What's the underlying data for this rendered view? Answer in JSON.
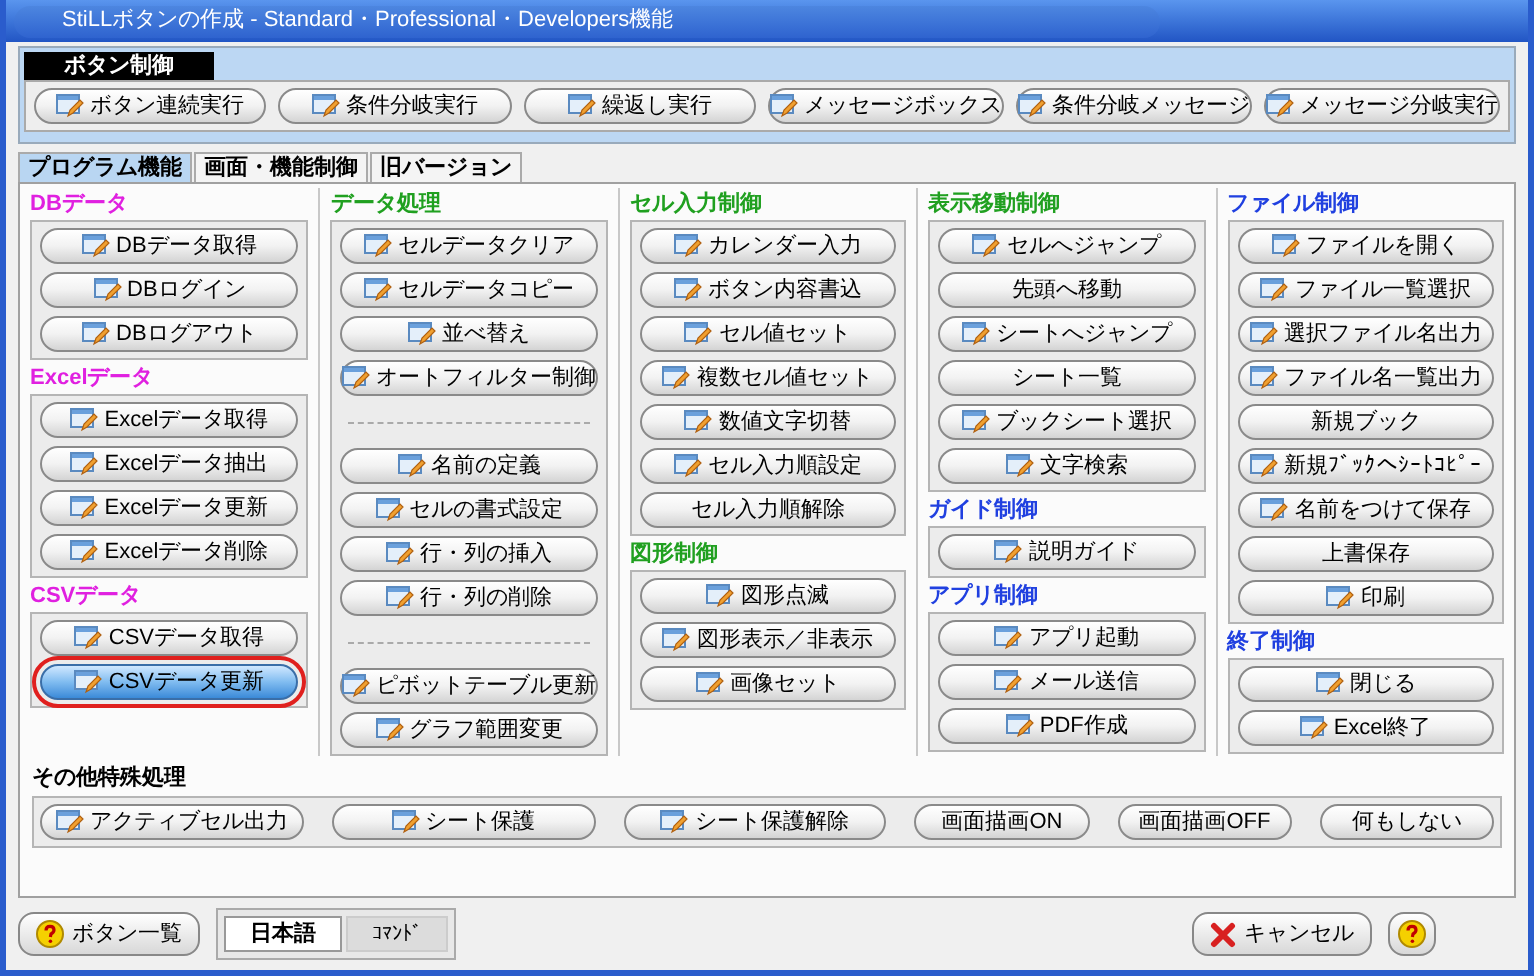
{
  "window": {
    "title": "StiLLボタンの作成 - Standard・Professional・Developers機能"
  },
  "button_control": {
    "title": "ボタン制御",
    "buttons": [
      {
        "label": "ボタン連続実行",
        "icon": true
      },
      {
        "label": "条件分岐実行",
        "icon": true
      },
      {
        "label": "繰返し実行",
        "icon": true
      },
      {
        "label": "メッセージボックス",
        "icon": true
      },
      {
        "label": "条件分岐メッセージ",
        "icon": true
      },
      {
        "label": "メッセージ分岐実行",
        "icon": true
      }
    ]
  },
  "tabs": [
    {
      "label": "プログラム機能",
      "selected": true
    },
    {
      "label": "画面・機能制御",
      "selected": false
    },
    {
      "label": "旧バージョン",
      "selected": false
    }
  ],
  "columns": [
    [
      {
        "title": "DBデータ",
        "color": "#e020e0",
        "items": [
          {
            "kind": "button",
            "label": "DBデータ取得",
            "icon": true,
            "selected": false
          },
          {
            "kind": "button",
            "label": "DBログイン",
            "icon": true,
            "selected": false
          },
          {
            "kind": "button",
            "label": "DBログアウト",
            "icon": true,
            "selected": false
          }
        ]
      },
      {
        "title": "Excelデータ",
        "color": "#e020e0",
        "items": [
          {
            "kind": "button",
            "label": "Excelデータ取得",
            "icon": true,
            "selected": false
          },
          {
            "kind": "button",
            "label": "Excelデータ抽出",
            "icon": true,
            "selected": false
          },
          {
            "kind": "button",
            "label": "Excelデータ更新",
            "icon": true,
            "selected": false
          },
          {
            "kind": "button",
            "label": "Excelデータ削除",
            "icon": true,
            "selected": false
          }
        ]
      },
      {
        "title": "CSVデータ",
        "color": "#e020e0",
        "items": [
          {
            "kind": "button",
            "label": "CSVデータ取得",
            "icon": true,
            "selected": false
          },
          {
            "kind": "button",
            "label": "CSVデータ更新",
            "icon": true,
            "selected": true
          }
        ]
      }
    ],
    [
      {
        "title": "データ処理",
        "color": "#20a020",
        "items": [
          {
            "kind": "button",
            "label": "セルデータクリア",
            "icon": true,
            "selected": false
          },
          {
            "kind": "button",
            "label": "セルデータコピー",
            "icon": true,
            "selected": false
          },
          {
            "kind": "button",
            "label": "並べ替え",
            "icon": true,
            "selected": false
          },
          {
            "kind": "button",
            "label": "オートフィルター制御",
            "icon": true,
            "selected": false
          },
          {
            "kind": "separator"
          },
          {
            "kind": "button",
            "label": "名前の定義",
            "icon": true,
            "selected": false
          },
          {
            "kind": "button",
            "label": "セルの書式設定",
            "icon": true,
            "selected": false
          },
          {
            "kind": "button",
            "label": "行・列の挿入",
            "icon": true,
            "selected": false
          },
          {
            "kind": "button",
            "label": "行・列の削除",
            "icon": true,
            "selected": false
          },
          {
            "kind": "separator"
          },
          {
            "kind": "button",
            "label": "ピボットテーブル更新",
            "icon": true,
            "selected": false
          },
          {
            "kind": "button",
            "label": "グラフ範囲変更",
            "icon": true,
            "selected": false
          }
        ]
      }
    ],
    [
      {
        "title": "セル入力制御",
        "color": "#20a020",
        "items": [
          {
            "kind": "button",
            "label": "カレンダー入力",
            "icon": true,
            "selected": false
          },
          {
            "kind": "button",
            "label": "ボタン内容書込",
            "icon": true,
            "selected": false
          },
          {
            "kind": "button",
            "label": "セル値セット",
            "icon": true,
            "selected": false
          },
          {
            "kind": "button",
            "label": "複数セル値セット",
            "icon": true,
            "selected": false
          },
          {
            "kind": "button",
            "label": "数値文字切替",
            "icon": true,
            "selected": false
          },
          {
            "kind": "button",
            "label": "セル入力順設定",
            "icon": true,
            "selected": false
          },
          {
            "kind": "button",
            "label": "セル入力順解除",
            "icon": false,
            "selected": false
          }
        ]
      },
      {
        "title": "図形制御",
        "color": "#20a020",
        "items": [
          {
            "kind": "button",
            "label": "図形点滅",
            "icon": true,
            "selected": false
          },
          {
            "kind": "button",
            "label": "図形表示／非表示",
            "icon": true,
            "selected": false
          },
          {
            "kind": "button",
            "label": "画像セット",
            "icon": true,
            "selected": false
          }
        ]
      }
    ],
    [
      {
        "title": "表示移動制御",
        "color": "#20a020",
        "items": [
          {
            "kind": "button",
            "label": "セルへジャンプ",
            "icon": true,
            "selected": false
          },
          {
            "kind": "button",
            "label": "先頭へ移動",
            "icon": false,
            "selected": false
          },
          {
            "kind": "button",
            "label": "シートへジャンプ",
            "icon": true,
            "selected": false
          },
          {
            "kind": "button",
            "label": "シート一覧",
            "icon": false,
            "selected": false
          },
          {
            "kind": "button",
            "label": "ブックシート選択",
            "icon": true,
            "selected": false
          },
          {
            "kind": "button",
            "label": "文字検索",
            "icon": true,
            "selected": false
          }
        ]
      },
      {
        "title": "ガイド制御",
        "color": "#2040e0",
        "items": [
          {
            "kind": "button",
            "label": "説明ガイド",
            "icon": true,
            "selected": false
          }
        ]
      },
      {
        "title": "アプリ制御",
        "color": "#2040e0",
        "items": [
          {
            "kind": "button",
            "label": "アプリ起動",
            "icon": true,
            "selected": false
          },
          {
            "kind": "button",
            "label": "メール送信",
            "icon": true,
            "selected": false
          },
          {
            "kind": "button",
            "label": "PDF作成",
            "icon": true,
            "selected": false
          }
        ]
      }
    ],
    [
      {
        "title": "ファイル制御",
        "color": "#2040e0",
        "items": [
          {
            "kind": "button",
            "label": "ファイルを開く",
            "icon": true,
            "selected": false
          },
          {
            "kind": "button",
            "label": "ファイル一覧選択",
            "icon": true,
            "selected": false
          },
          {
            "kind": "button",
            "label": "選択ファイル名出力",
            "icon": true,
            "selected": false
          },
          {
            "kind": "button",
            "label": "ファイル名一覧出力",
            "icon": true,
            "selected": false
          },
          {
            "kind": "button",
            "label": "新規ブック",
            "icon": false,
            "selected": false
          },
          {
            "kind": "button",
            "label": "新規ﾌﾞｯｸへｼｰﾄｺﾋﾟｰ",
            "icon": true,
            "selected": false
          },
          {
            "kind": "button",
            "label": "名前をつけて保存",
            "icon": true,
            "selected": false
          },
          {
            "kind": "button",
            "label": "上書保存",
            "icon": false,
            "selected": false
          },
          {
            "kind": "button",
            "label": "印刷",
            "icon": true,
            "selected": false
          }
        ]
      },
      {
        "title": "終了制御",
        "color": "#2040e0",
        "items": [
          {
            "kind": "button",
            "label": "閉じる",
            "icon": true,
            "selected": false
          },
          {
            "kind": "button",
            "label": "Excel終了",
            "icon": true,
            "selected": false
          }
        ]
      }
    ]
  ],
  "other": {
    "title": "その他特殊処理",
    "buttons": [
      {
        "label": "アクティブセル出力",
        "icon": true
      },
      {
        "label": "シート保護",
        "icon": true
      },
      {
        "label": "シート保護解除",
        "icon": true
      },
      {
        "label": "画面描画ON",
        "icon": false
      },
      {
        "label": "画面描画OFF",
        "icon": false
      },
      {
        "label": "何もしない",
        "icon": false
      }
    ]
  },
  "footer": {
    "list_button": "ボタン一覧",
    "languages": [
      {
        "label": "日本語",
        "selected": true
      },
      {
        "label": "ｺﾏﾝﾄﾞ",
        "selected": false
      }
    ],
    "cancel_button": "キャンセル"
  }
}
